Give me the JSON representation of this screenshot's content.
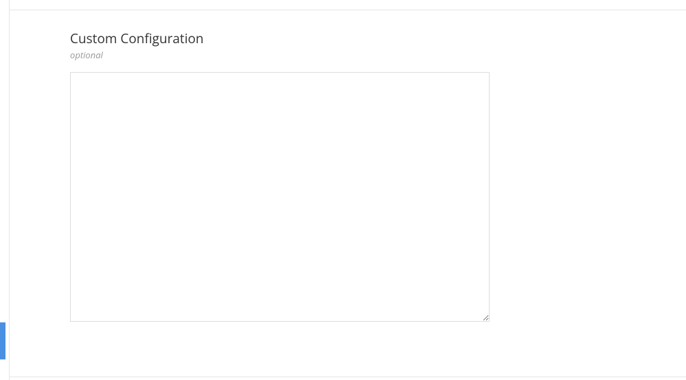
{
  "section": {
    "title": "Custom Configuration",
    "subtitle": "optional",
    "textarea_value": ""
  }
}
